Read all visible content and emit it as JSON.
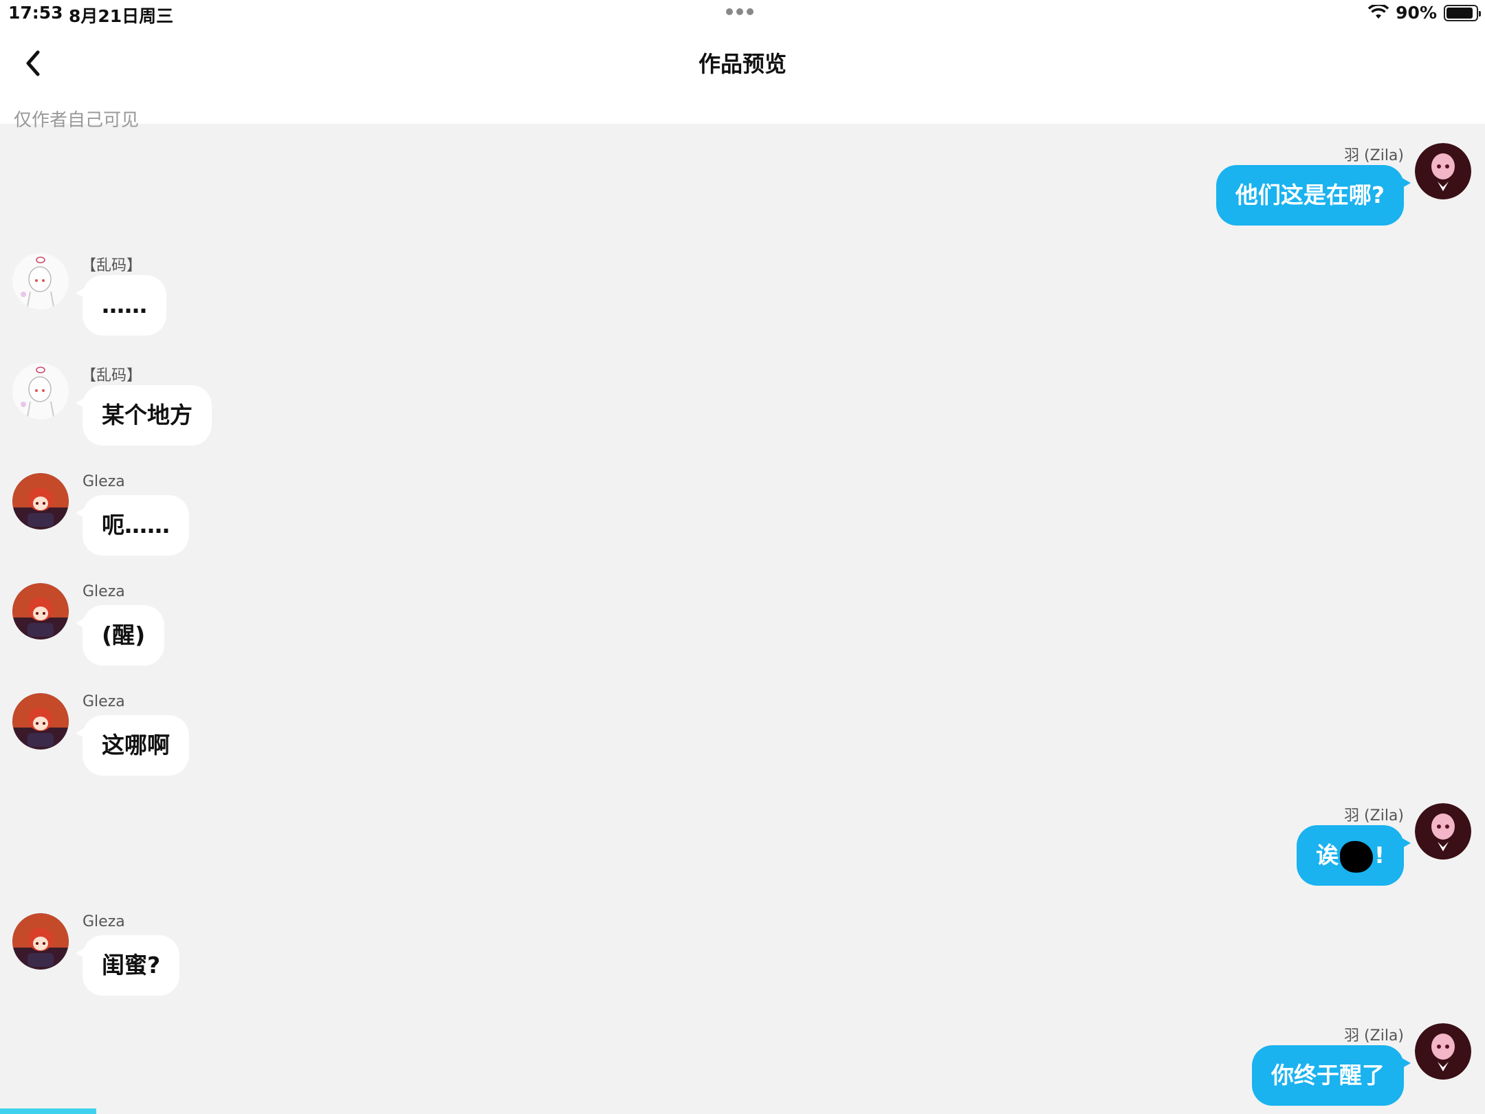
{
  "status_bar": {
    "time": "17:53",
    "date": "8月21日周三",
    "battery": "90%",
    "battery_level": 0.9
  },
  "nav": {
    "title": "作品预览",
    "subtitle": "仅作者自己可见"
  },
  "messages": [
    {
      "side": "right",
      "sender": "羽 (Zila)",
      "text": "他们这是在哪?",
      "avatar": "zila-avatar"
    },
    {
      "side": "left",
      "sender": "【乱码】",
      "text": "……",
      "avatar": "luanma-avatar"
    },
    {
      "side": "left",
      "sender": "【乱码】",
      "text": "某个地方",
      "avatar": "luanma-avatar"
    },
    {
      "side": "left",
      "sender": "Gleza",
      "text": "呃……",
      "avatar": "gleza-avatar"
    },
    {
      "side": "left",
      "sender": "Gleza",
      "text": "(醒)",
      "avatar": "gleza-avatar"
    },
    {
      "side": "left",
      "sender": "Gleza",
      "text": "这哪啊",
      "avatar": "gleza-avatar"
    },
    {
      "side": "right",
      "sender": "羽 (Zila)",
      "text_before": "诶",
      "text_after": "!",
      "avatar": "zila-avatar"
    },
    {
      "side": "left",
      "sender": "Gleza",
      "text": "闺蜜?",
      "avatar": "gleza-avatar"
    },
    {
      "side": "right",
      "sender": "羽 (Zila)",
      "text": "你终于醒了",
      "avatar": "zila-avatar"
    }
  ],
  "colors": {
    "right_bubble": "#1ab2ef",
    "left_bubble": "#ffffff",
    "background": "#f2f2f2",
    "bottom_accent": "#3fd2ee"
  }
}
